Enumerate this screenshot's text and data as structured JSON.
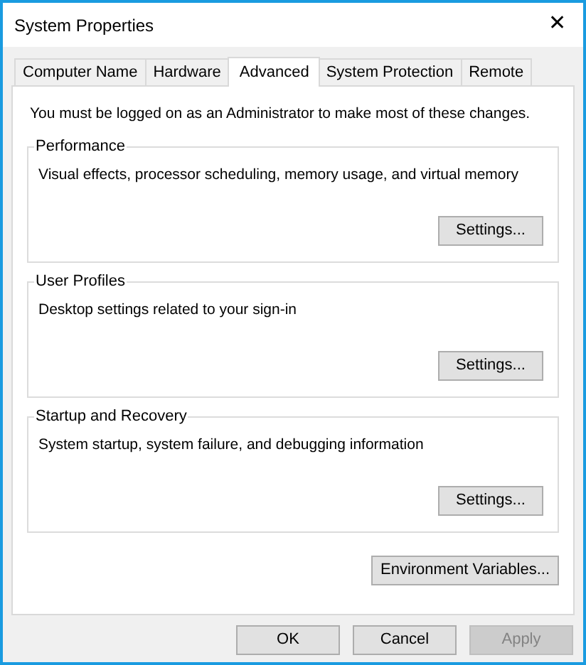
{
  "window": {
    "title": "System Properties",
    "close": "✕"
  },
  "tabs": [
    {
      "label": "Computer Name",
      "selected": false
    },
    {
      "label": "Hardware",
      "selected": false
    },
    {
      "label": "Advanced",
      "selected": true
    },
    {
      "label": "System Protection",
      "selected": false
    },
    {
      "label": "Remote",
      "selected": false
    }
  ],
  "notice": "You must be logged on as an Administrator to make most of these changes.",
  "groups": [
    {
      "title": "Performance",
      "description": "Visual effects, processor scheduling, memory usage, and virtual memory",
      "button": "Settings..."
    },
    {
      "title": "User Profiles",
      "description": "Desktop settings related to your sign-in",
      "button": "Settings..."
    },
    {
      "title": "Startup and Recovery",
      "description": "System startup, system failure, and debugging information",
      "button": "Settings..."
    }
  ],
  "environment_button": "Environment Variables...",
  "buttons": [
    {
      "label": "OK",
      "disabled": false
    },
    {
      "label": "Cancel",
      "disabled": false
    },
    {
      "label": "Apply",
      "disabled": true
    }
  ]
}
